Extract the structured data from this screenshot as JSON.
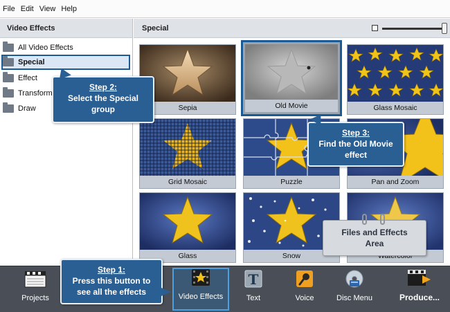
{
  "menu": [
    "File",
    "Edit",
    "View",
    "Help"
  ],
  "left_panel": {
    "title": "Video Effects",
    "items": [
      {
        "label": "All Video Effects"
      },
      {
        "label": "Special"
      },
      {
        "label": "Effect"
      },
      {
        "label": "Transform"
      },
      {
        "label": "Draw"
      }
    ]
  },
  "right_panel": {
    "title": "Special",
    "tiles": [
      {
        "label": "Sepia"
      },
      {
        "label": "Old Movie"
      },
      {
        "label": "Glass Mosaic"
      },
      {
        "label": "Grid Mosaic"
      },
      {
        "label": "Puzzle"
      },
      {
        "label": "Pan and Zoom"
      },
      {
        "label": "Glass"
      },
      {
        "label": "Snow"
      },
      {
        "label": "Watercolor"
      }
    ]
  },
  "toolbar": {
    "projects": "Projects",
    "video_effects": "Video Effects",
    "text": "Text",
    "voice": "Voice",
    "disc_menu": "Disc Menu",
    "produce": "Produce..."
  },
  "callouts": {
    "step1": {
      "title": "Step 1:",
      "line1": "Press this button to",
      "line2": "see all the effects"
    },
    "step2": {
      "title": "Step 2:",
      "line1": "Select the Special",
      "line2": "group"
    },
    "step3": {
      "title": "Step 3:",
      "line1": "Find the Old Movie",
      "line2": "effect"
    }
  },
  "note": {
    "line1": "Files and Effects",
    "line2": "Area"
  },
  "colors": {
    "accent": "#1c5a94",
    "callout": "#2a5f93",
    "toolbar": "#4a4f57"
  }
}
